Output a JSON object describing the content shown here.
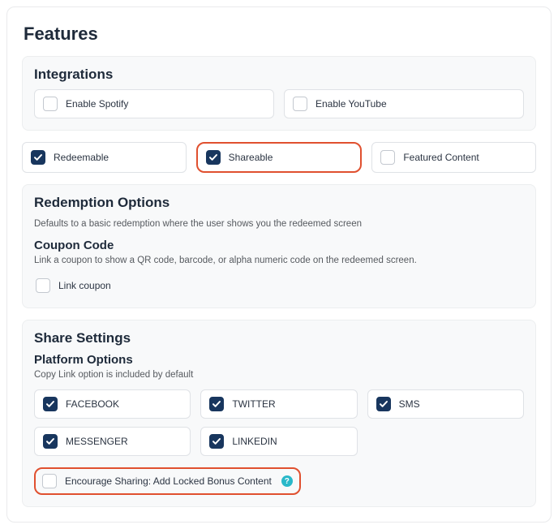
{
  "page": {
    "title": "Features"
  },
  "integrations": {
    "title": "Integrations",
    "spotify": {
      "label": "Enable Spotify",
      "checked": false
    },
    "youtube": {
      "label": "Enable YouTube",
      "checked": false
    }
  },
  "features": {
    "redeemable": {
      "label": "Redeemable",
      "checked": true
    },
    "shareable": {
      "label": "Shareable",
      "checked": true
    },
    "featured": {
      "label": "Featured Content",
      "checked": false
    }
  },
  "redemption": {
    "title": "Redemption Options",
    "helper": "Defaults to a basic redemption where the user shows you the redeemed screen",
    "coupon_title": "Coupon Code",
    "coupon_helper": "Link a coupon to show a QR code, barcode, or alpha numeric code on the redeemed screen.",
    "link_coupon": {
      "label": "Link coupon",
      "checked": false
    }
  },
  "share": {
    "title": "Share Settings",
    "platform_title": "Platform Options",
    "platform_helper": "Copy Link option is included by default",
    "platforms": {
      "facebook": {
        "label": "FACEBOOK",
        "checked": true
      },
      "twitter": {
        "label": "TWITTER",
        "checked": true
      },
      "sms": {
        "label": "SMS",
        "checked": true
      },
      "messenger": {
        "label": "MESSENGER",
        "checked": true
      },
      "linkedin": {
        "label": "LINKEDIN",
        "checked": true
      }
    },
    "encourage": {
      "label": "Encourage Sharing: Add Locked Bonus Content",
      "checked": false
    }
  },
  "colors": {
    "checkbox_fill": "#18365e",
    "highlight": "#e0502f",
    "help_icon": "#29b8c9"
  }
}
